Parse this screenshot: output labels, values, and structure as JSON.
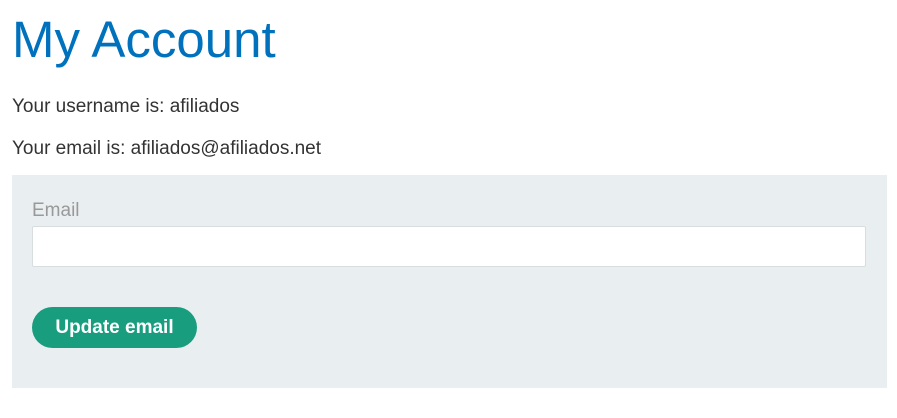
{
  "page": {
    "title": "My Account"
  },
  "account": {
    "username_line": "Your username is: afiliados",
    "email_line": "Your email is: afiliados@afiliados.net"
  },
  "form": {
    "email_label": "Email",
    "email_value": "",
    "submit_label": "Update email"
  },
  "colors": {
    "title": "#0071bc",
    "panel_background": "#e9eef1",
    "button_background": "#189e7f",
    "button_text": "#ffffff",
    "label_text": "#999999"
  }
}
